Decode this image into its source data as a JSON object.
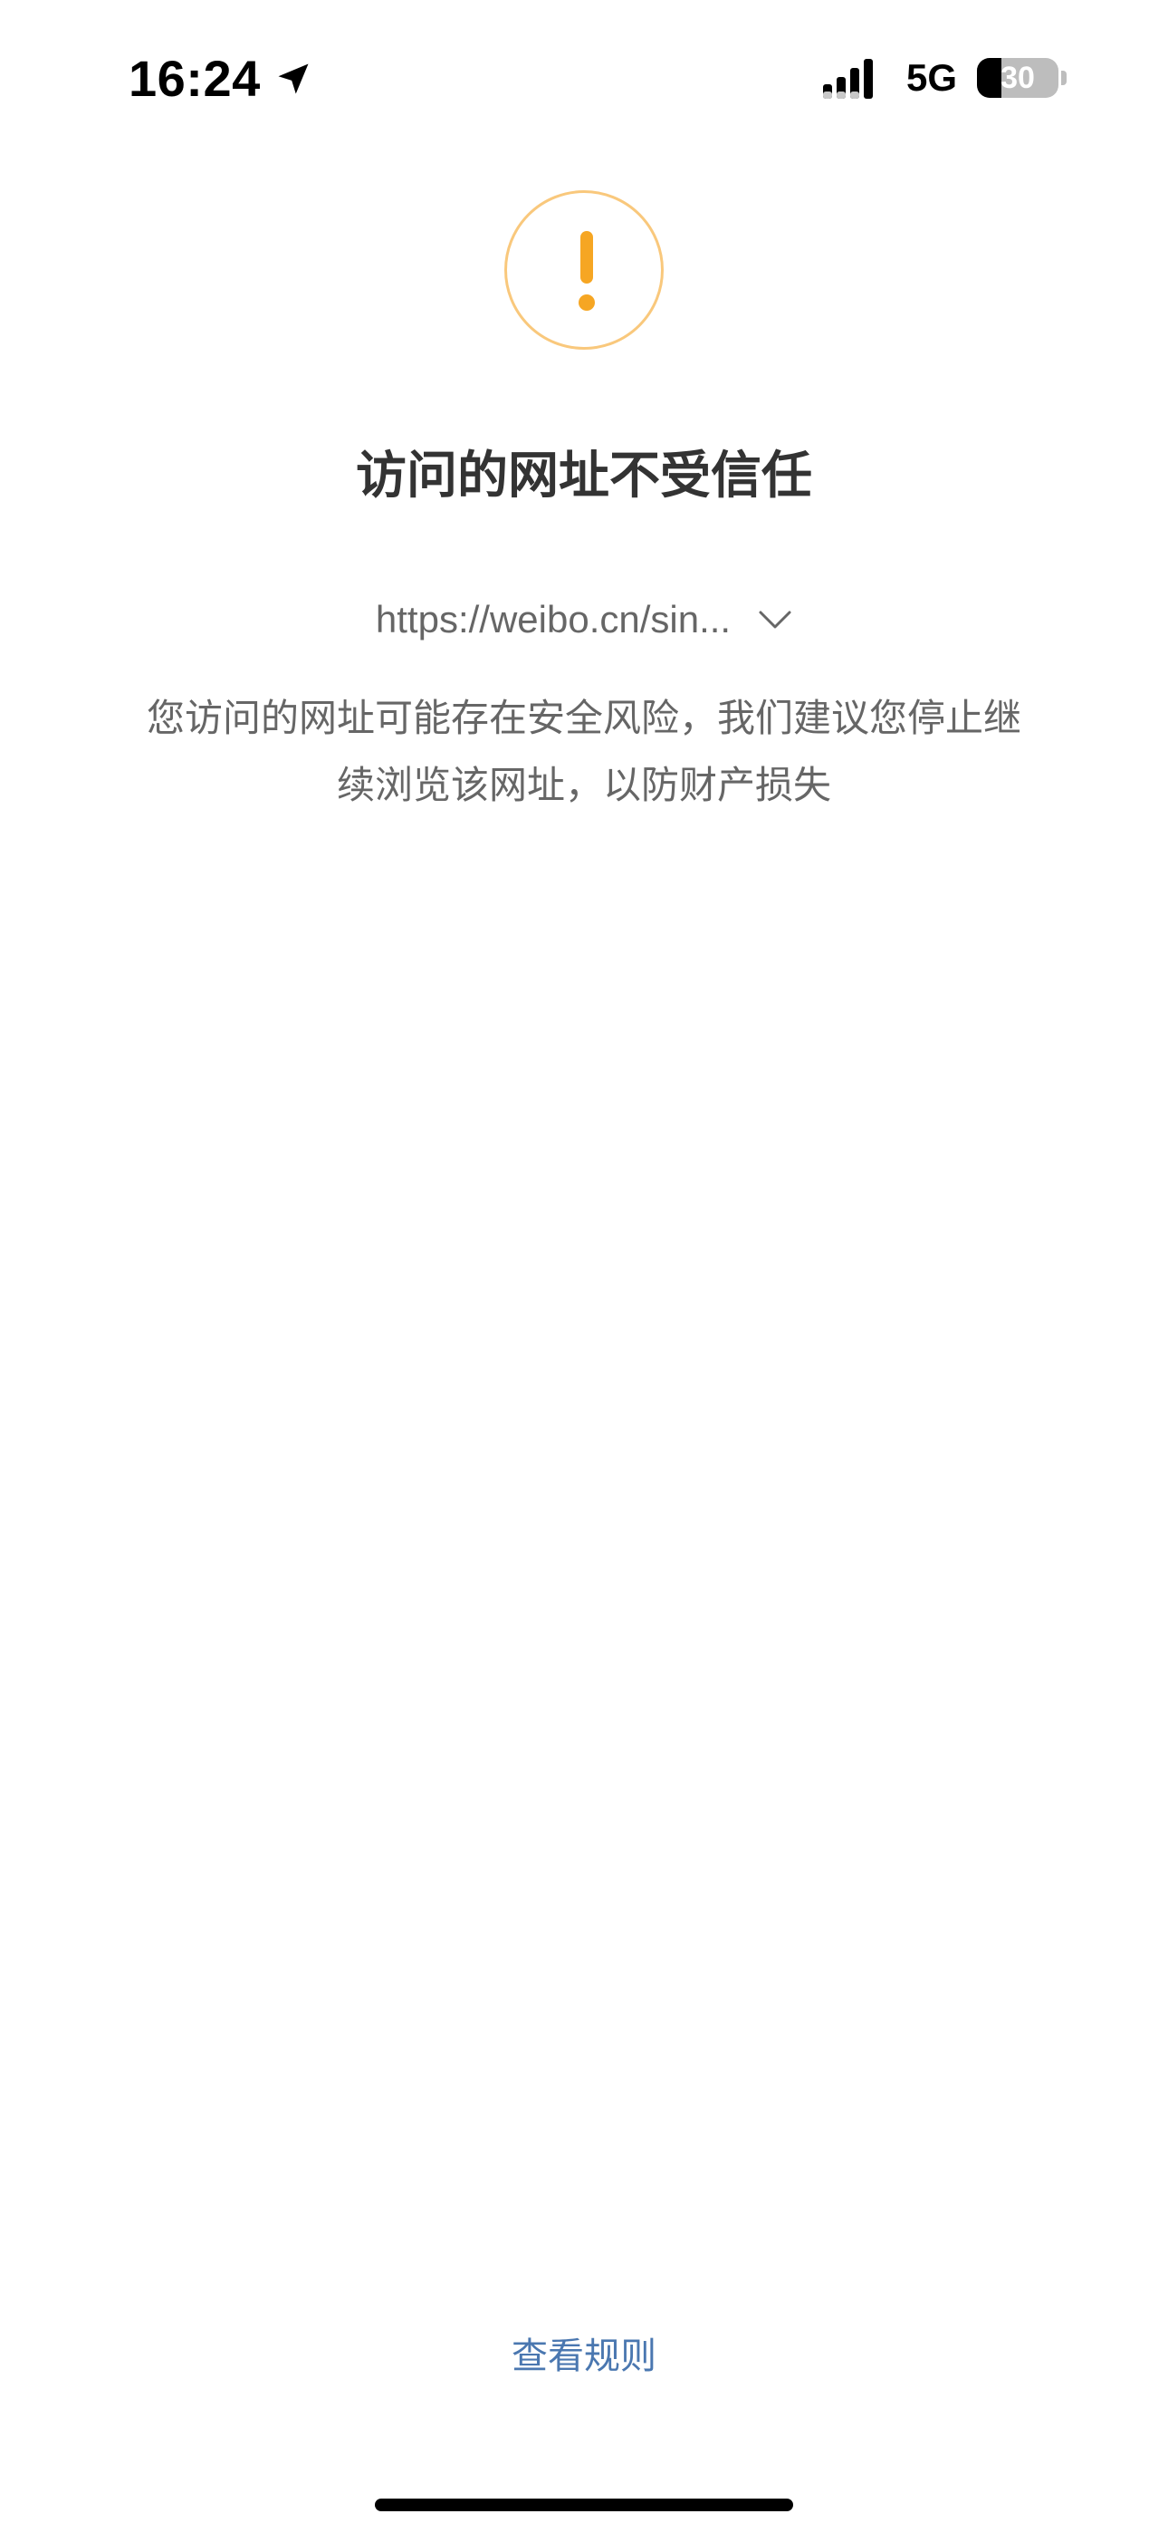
{
  "status_bar": {
    "time": "16:24",
    "network": "5G",
    "battery_level": "30",
    "battery_fraction": 0.3
  },
  "warning": {
    "icon": "exclamation-icon",
    "accent_color": "#f6a623"
  },
  "title": "访问的网址不受信任",
  "url": "https://weibo.cn/sin...",
  "description": "您访问的网址可能存在安全风险，我们建议您停止继续浏览该网址，以防财产损失",
  "rules_link": "查看规则",
  "colors": {
    "title": "#333333",
    "body_text": "#666666",
    "link": "#4a77b0"
  }
}
